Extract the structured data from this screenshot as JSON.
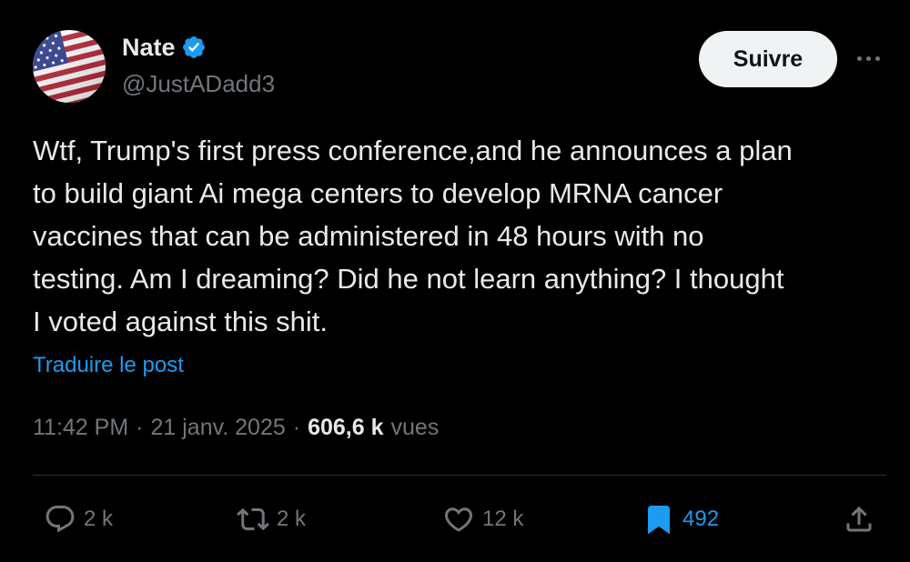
{
  "author": {
    "name": "Nate",
    "handle": "@JustADadd3",
    "verified": true,
    "avatar_icon": "us-flag-avatar"
  },
  "follow_label": "Suivre",
  "more_icon": "more-horizontal-icon",
  "tweet_text": "Wtf, Trump's first press conference,and he announces a plan\nto build giant Ai mega centers to develop MRNA cancer\nvaccines that can be administered in 48 hours with no\ntesting. Am I dreaming? Did he not learn anything? I thought\nI voted against this shit.",
  "translate_label": "Traduire le post",
  "meta": {
    "time": "11:42 PM",
    "separator": "·",
    "date": "21 janv. 2025",
    "views_count": "606,6 k",
    "views_label": "vues"
  },
  "actions": {
    "reply": {
      "icon": "reply-icon",
      "count": "2 k"
    },
    "repost": {
      "icon": "repost-icon",
      "count": "2 k"
    },
    "like": {
      "icon": "heart-icon",
      "count": "12 k"
    },
    "bookmark": {
      "icon": "bookmark-icon",
      "count": "492"
    },
    "share": {
      "icon": "share-icon"
    }
  },
  "colors": {
    "background": "#000000",
    "text": "#e7e9ea",
    "secondary": "#71767b",
    "accent": "#1d9bf0",
    "follow_bg": "#eff3f4"
  }
}
